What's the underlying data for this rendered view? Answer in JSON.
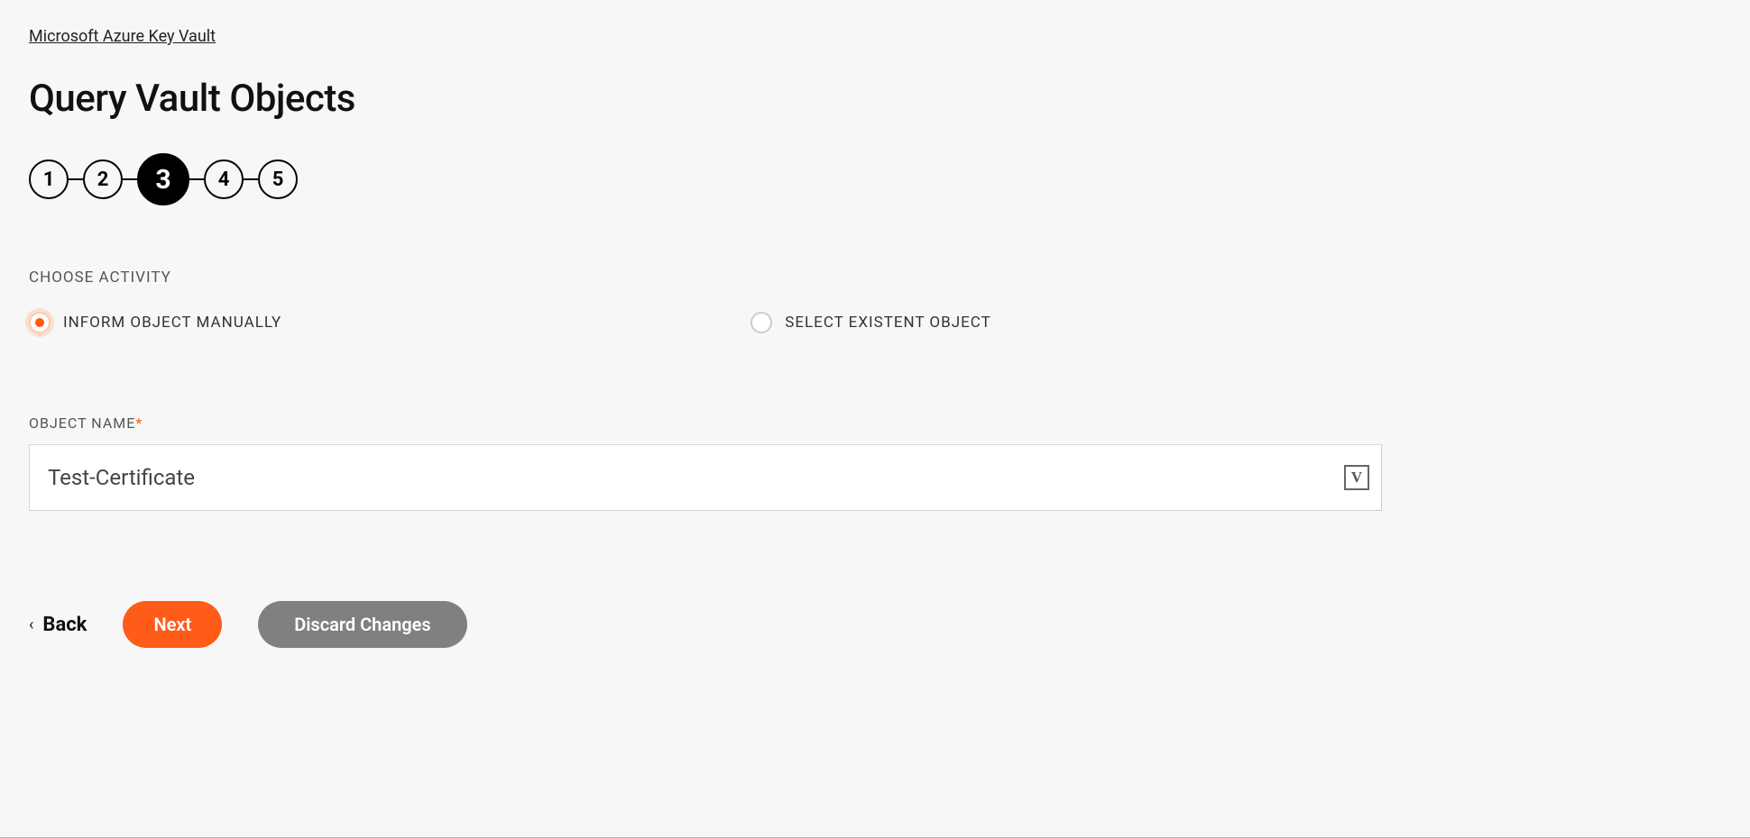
{
  "breadcrumb": {
    "label": "Microsoft Azure Key Vault"
  },
  "page": {
    "title": "Query Vault Objects"
  },
  "stepper": {
    "steps": [
      "1",
      "2",
      "3",
      "4",
      "5"
    ],
    "active_index": 2
  },
  "activity": {
    "section_label": "CHOOSE ACTIVITY",
    "options": [
      {
        "id": "inform-manual",
        "label": "INFORM OBJECT MANUALLY",
        "selected": true
      },
      {
        "id": "select-existent",
        "label": "SELECT EXISTENT OBJECT",
        "selected": false
      }
    ]
  },
  "object_name": {
    "label": "OBJECT NAME",
    "required_mark": "*",
    "value": "Test-Certificate",
    "badge": "V"
  },
  "footer": {
    "back": "Back",
    "next": "Next",
    "discard": "Discard Changes"
  }
}
